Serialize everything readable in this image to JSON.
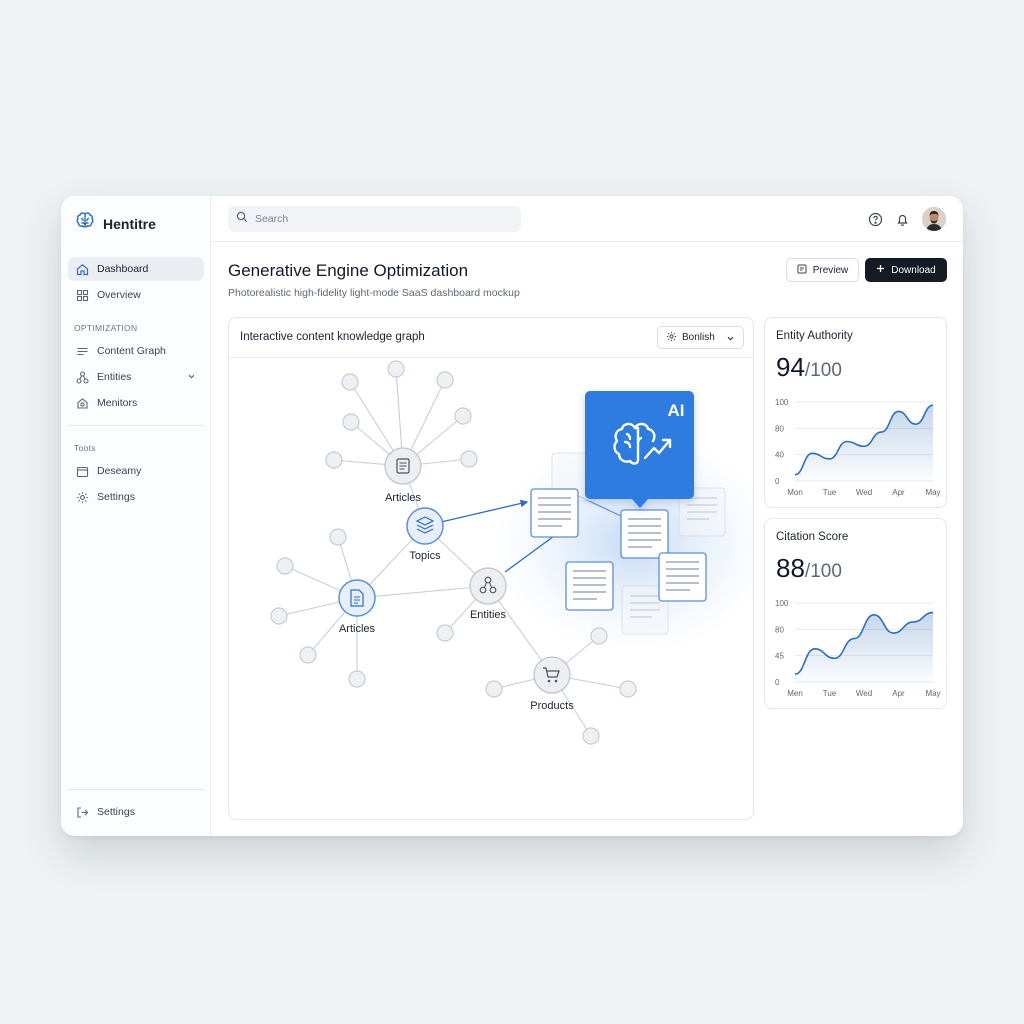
{
  "app": {
    "brand": "Hentitre"
  },
  "sidebar": {
    "items": [
      {
        "label": "Dashboard",
        "icon": "home-icon",
        "active": true
      },
      {
        "label": "Overview",
        "icon": "grid-icon"
      }
    ],
    "optimization_label": "OPTIMIZATION",
    "optimization_items": [
      {
        "label": "Content Graph",
        "icon": "lines-icon"
      },
      {
        "label": "Entities",
        "icon": "nodes-icon"
      },
      {
        "label": "Menitors",
        "icon": "monitor-icon"
      }
    ],
    "tools_label": "Toots",
    "tools_items": [
      {
        "label": "Deseamy",
        "icon": "calendar-icon"
      },
      {
        "label": "Settings",
        "icon": "gear-icon"
      }
    ],
    "footer_item": {
      "label": "Settings",
      "icon": "logout-icon"
    }
  },
  "topbar": {
    "search_placeholder": "Search"
  },
  "header": {
    "title": "Generative Engine Optimization",
    "subtitle": "Photorealistic high-fidelity light-mode SaaS dashboard mockup",
    "preview_label": "Preview",
    "download_label": "Download"
  },
  "graph": {
    "title": "Interactive content knowledge graph",
    "filter_label": "Bonlish",
    "nodes": [
      {
        "label": "Articles"
      },
      {
        "label": "Topics"
      },
      {
        "label": "Articles"
      },
      {
        "label": "Entities"
      },
      {
        "label": "Products"
      }
    ],
    "ai_badge": "AI"
  },
  "metrics": [
    {
      "title": "Entity Authority",
      "value": "94",
      "max": "/100",
      "chart_data": {
        "type": "area",
        "categories": [
          "Mon",
          "Tue",
          "Wed",
          "Apr",
          "May"
        ],
        "values": [
          8,
          35,
          28,
          50,
          44,
          62,
          88,
          72,
          96
        ],
        "ylim": [
          0,
          100
        ],
        "y_ticks": [
          "100",
          "80",
          "40",
          "0"
        ],
        "color": "#2f6db8"
      }
    },
    {
      "title": "Citation Score",
      "value": "88",
      "max": "/100",
      "chart_data": {
        "type": "area",
        "categories": [
          "Men",
          "Tue",
          "Wed",
          "Apr",
          "May"
        ],
        "values": [
          10,
          42,
          30,
          55,
          85,
          62,
          76,
          88
        ],
        "ylim": [
          0,
          100
        ],
        "y_ticks": [
          "100",
          "80",
          "45",
          "0"
        ],
        "color": "#2f6db8"
      }
    }
  ]
}
